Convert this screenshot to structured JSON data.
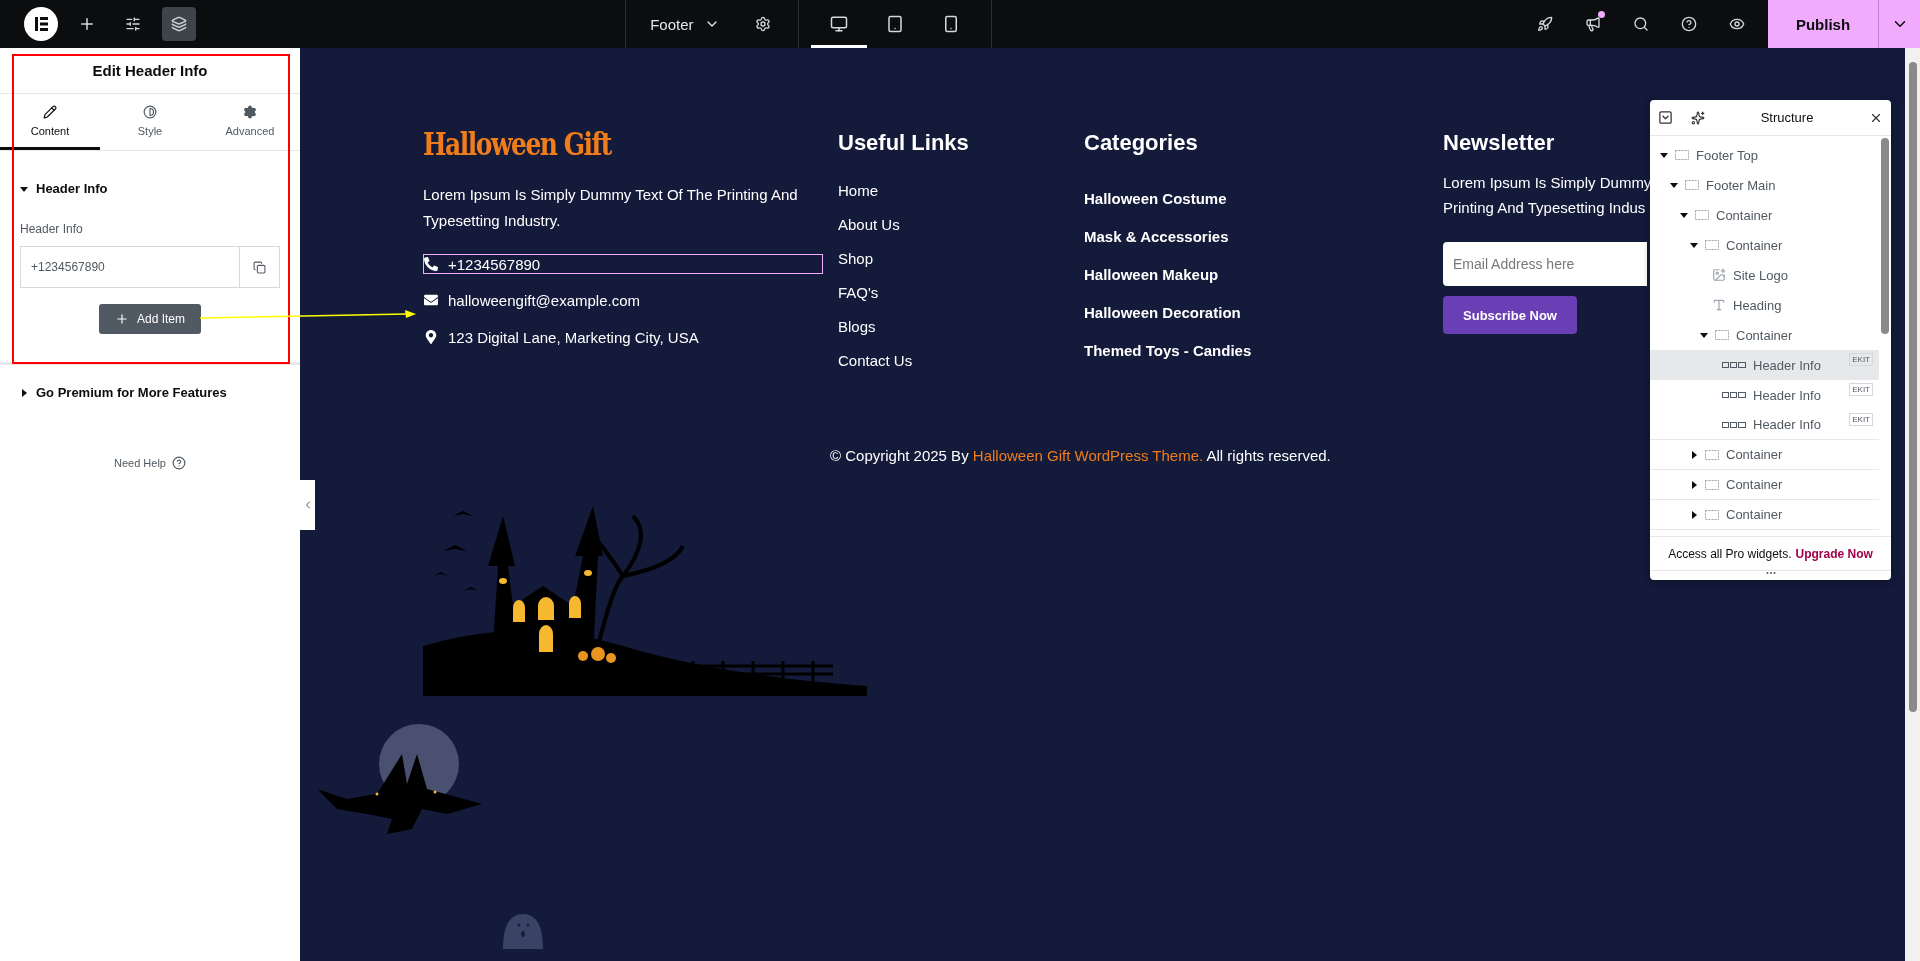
{
  "topbar": {
    "document": "Footer",
    "devices": [
      {
        "kind": "desktop",
        "selected": true
      },
      {
        "kind": "tablet",
        "selected": false
      },
      {
        "kind": "mobile",
        "selected": false
      }
    ],
    "publish": "Publish"
  },
  "panel": {
    "title": "Edit Header Info",
    "tabs": [
      {
        "label": "Content",
        "kind": "content",
        "selected": true
      },
      {
        "label": "Style",
        "kind": "style",
        "selected": false
      },
      {
        "label": "Advanced",
        "kind": "advanced",
        "selected": false
      }
    ],
    "section": {
      "title": "Header Info",
      "expanded": true,
      "field_label": "Header Info",
      "items": [
        {
          "value": "+1234567890"
        }
      ],
      "add_button": "Add Item"
    },
    "premium": {
      "title": "Go Premium for More Features",
      "expanded": false
    },
    "help": "Need Help"
  },
  "footer": {
    "logo": "Halloween Gift",
    "about": "Lorem Ipsum Is Simply Dummy Text Of The Printing And Typesetting Industry.",
    "contacts": [
      {
        "kind": "phone",
        "text": "+1234567890",
        "selected": true
      },
      {
        "kind": "email",
        "text": "halloweengift@example.com",
        "selected": false
      },
      {
        "kind": "location",
        "text": "123 Digital Lane, Marketing City, USA",
        "selected": false
      }
    ],
    "links": {
      "title": "Useful Links",
      "items": [
        "Home",
        "About Us",
        "Shop",
        "FAQ's",
        "Blogs",
        "Contact Us"
      ]
    },
    "categories": {
      "title": "Categories",
      "items": [
        "Halloween Costume",
        "Mask & Accessories",
        "Halloween Makeup",
        "Halloween Decoration",
        "Themed Toys - Candies"
      ]
    },
    "newsletter": {
      "title": "Newsletter",
      "lines": [
        "Lorem Ipsum Is Simply Dummy",
        "Printing And Typesetting Indus"
      ],
      "placeholder": "Email Address here",
      "button": "Subscribe Now"
    },
    "copyright": {
      "before": "© Copyright 2025 By",
      "link": "Halloween Gift WordPress Theme.",
      "after": "All rights reserved."
    }
  },
  "structure": {
    "title": "Structure",
    "tree": [
      {
        "label": "Footer Top",
        "kind": "container",
        "expanded": true,
        "selected": false,
        "children": [
          {
            "label": "Footer Main",
            "kind": "container",
            "expanded": true,
            "selected": false,
            "children": [
              {
                "label": "Container",
                "kind": "container",
                "expanded": true,
                "selected": false,
                "children": [
                  {
                    "label": "Container",
                    "kind": "container",
                    "expanded": true,
                    "selected": false,
                    "children": [
                      {
                        "label": "Site Logo",
                        "kind": "image",
                        "selected": false
                      },
                      {
                        "label": "Heading",
                        "kind": "heading",
                        "selected": false
                      },
                      {
                        "label": "Container",
                        "kind": "container",
                        "expanded": true,
                        "selected": false,
                        "children": [
                          {
                            "label": "Header Info",
                            "kind": "widget",
                            "badge": "EKIT",
                            "selected": true
                          },
                          {
                            "label": "Header Info",
                            "kind": "widget",
                            "badge": "EKIT",
                            "selected": false
                          },
                          {
                            "label": "Header Info",
                            "kind": "widget",
                            "badge": "EKIT",
                            "selected": false
                          }
                        ]
                      }
                    ]
                  },
                  {
                    "label": "Container",
                    "kind": "container",
                    "expanded": false,
                    "selected": false
                  },
                  {
                    "label": "Container",
                    "kind": "container",
                    "expanded": false,
                    "selected": false
                  },
                  {
                    "label": "Container",
                    "kind": "container",
                    "expanded": false,
                    "selected": false
                  }
                ]
              }
            ]
          }
        ]
      }
    ],
    "promo": "Access all Pro widgets.",
    "upgrade": "Upgrade Now"
  }
}
